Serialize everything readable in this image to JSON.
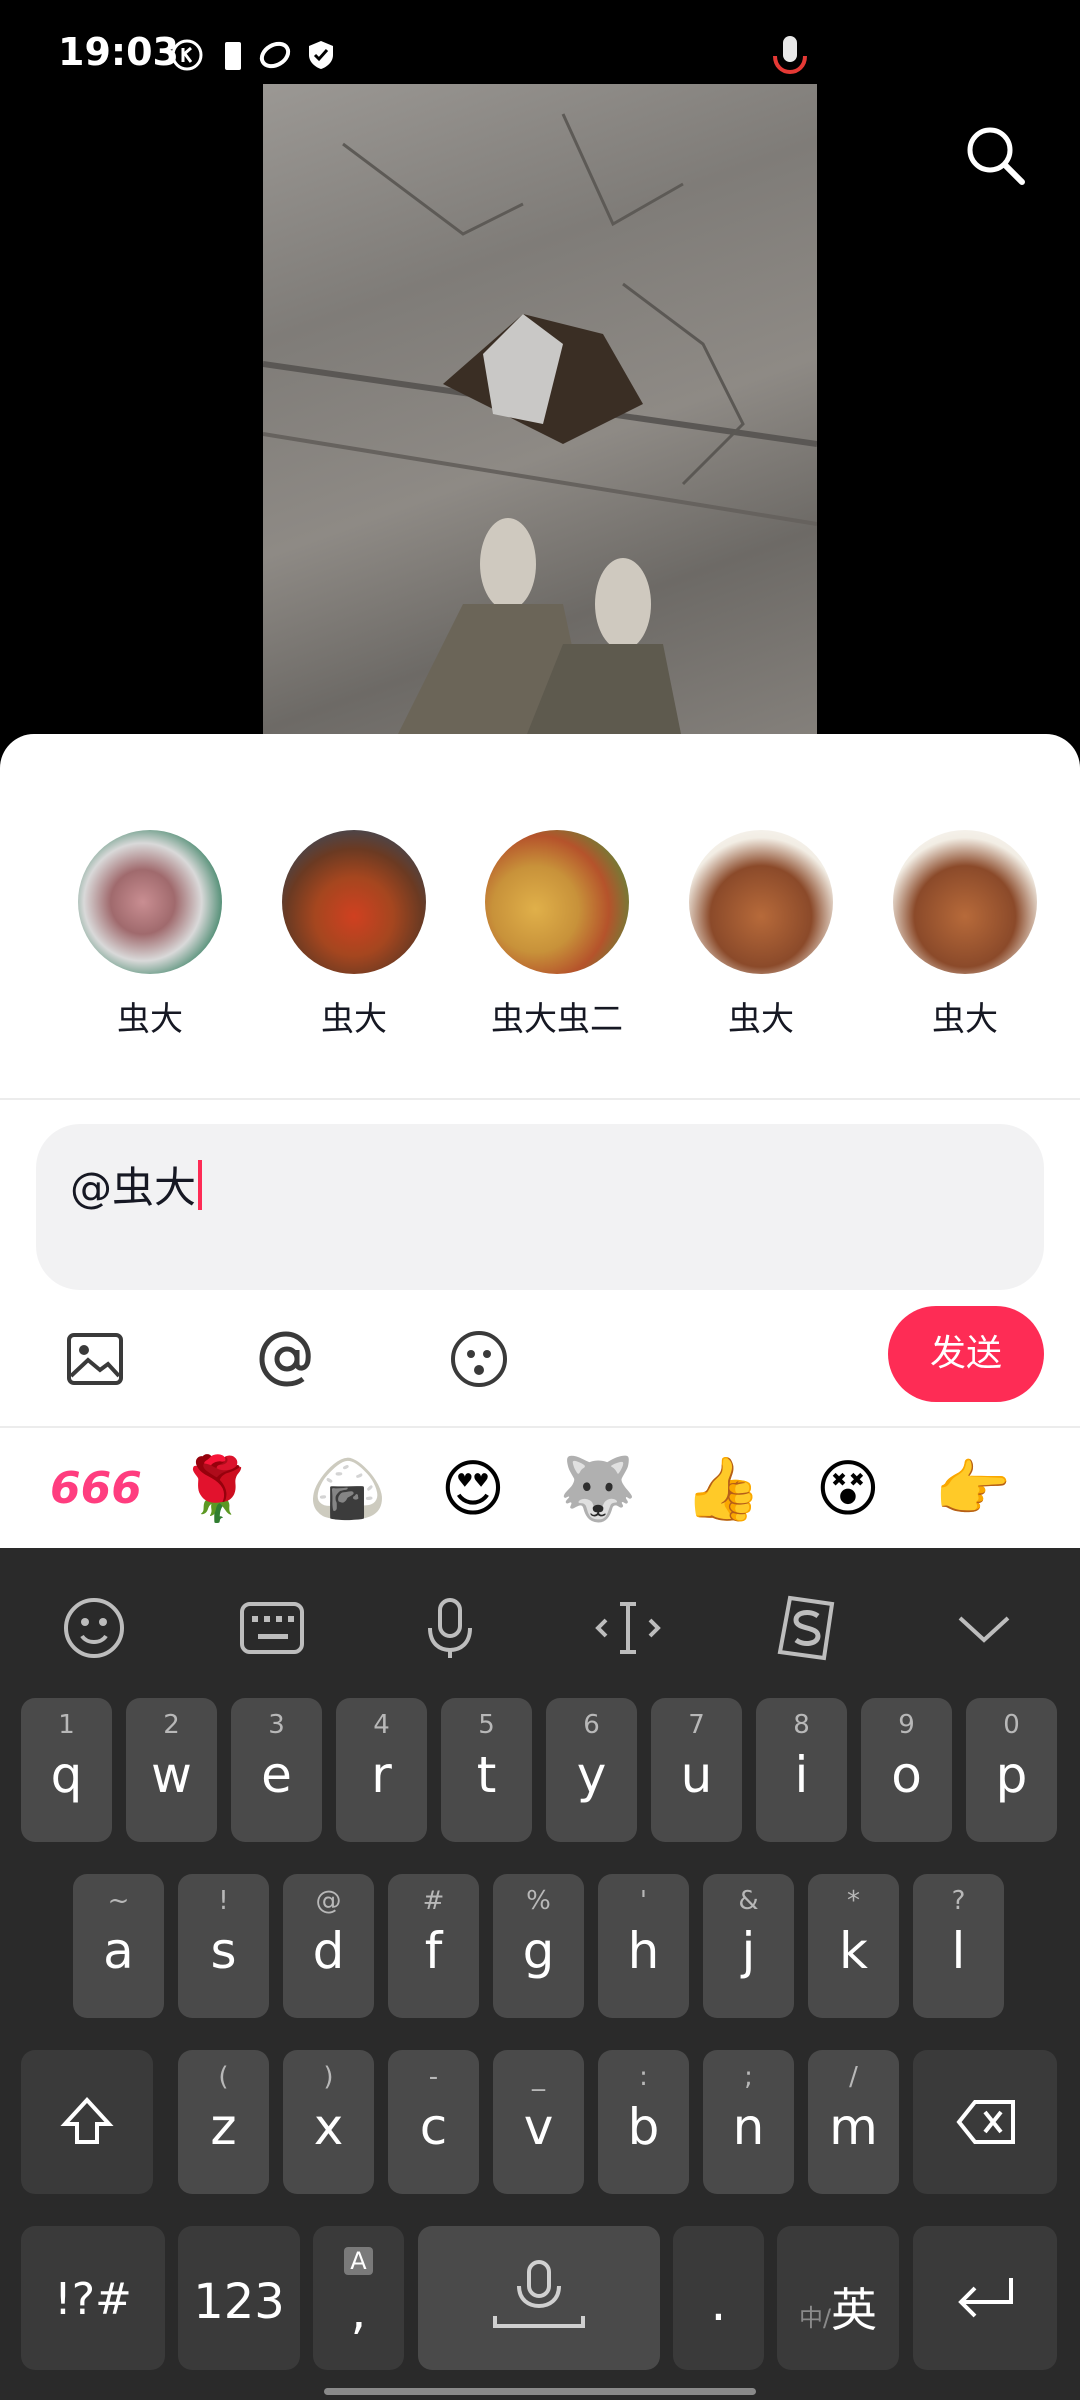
{
  "status_bar": {
    "time": "19:03"
  },
  "mentions": [
    {
      "name": "虫大"
    },
    {
      "name": "虫大"
    },
    {
      "name": "虫大虫二"
    },
    {
      "name": "虫大"
    },
    {
      "name": "虫大"
    }
  ],
  "comment": {
    "value": "@虫大"
  },
  "toolbar": {
    "send_label": "发送"
  },
  "quick_emojis": {
    "e1": "666",
    "e2": "🌹",
    "e3": "🍙",
    "e4": "😍",
    "e5": "🐺",
    "e6": "👍",
    "e7": "😵",
    "e8": "👉"
  },
  "keyboard": {
    "row1": [
      {
        "key": "q",
        "hint": "1"
      },
      {
        "key": "w",
        "hint": "2"
      },
      {
        "key": "e",
        "hint": "3"
      },
      {
        "key": "r",
        "hint": "4"
      },
      {
        "key": "t",
        "hint": "5"
      },
      {
        "key": "y",
        "hint": "6"
      },
      {
        "key": "u",
        "hint": "7"
      },
      {
        "key": "i",
        "hint": "8"
      },
      {
        "key": "o",
        "hint": "9"
      },
      {
        "key": "p",
        "hint": "0"
      }
    ],
    "row2": [
      {
        "key": "a",
        "hint": "~"
      },
      {
        "key": "s",
        "hint": "!"
      },
      {
        "key": "d",
        "hint": "@"
      },
      {
        "key": "f",
        "hint": "#"
      },
      {
        "key": "g",
        "hint": "%"
      },
      {
        "key": "h",
        "hint": "'"
      },
      {
        "key": "j",
        "hint": "&"
      },
      {
        "key": "k",
        "hint": "*"
      },
      {
        "key": "l",
        "hint": "?"
      }
    ],
    "row3": [
      {
        "key": "z",
        "hint": "("
      },
      {
        "key": "x",
        "hint": ")"
      },
      {
        "key": "c",
        "hint": "-"
      },
      {
        "key": "v",
        "hint": "_"
      },
      {
        "key": "b",
        "hint": ":"
      },
      {
        "key": "n",
        "hint": ";"
      },
      {
        "key": "m",
        "hint": "/"
      }
    ],
    "symbols_label": "!?#",
    "numbers_label": "123",
    "comma_label": ",",
    "comma_hint": "A",
    "period_label": ".",
    "lang_label": "英",
    "lang_hint": "中/"
  },
  "colors": {
    "accent": "#fe2c55",
    "keyboard_bg": "#2a2a2a",
    "key_bg": "#4a4a4a"
  }
}
